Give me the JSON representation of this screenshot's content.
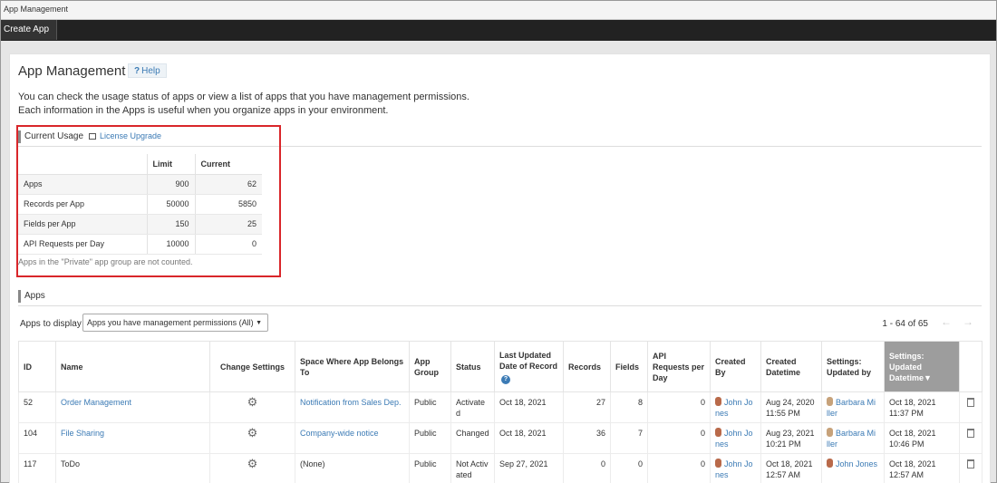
{
  "window_title": "App Management",
  "topbar": {
    "create_app": "Create App"
  },
  "header": {
    "title": "App Management",
    "help_label": "Help",
    "help_icon": "question-icon"
  },
  "description": {
    "line1": "You can check the usage status of apps or view a list of apps that you have management permissions.",
    "line2": "Each information in the Apps is useful when you organize apps in your environment."
  },
  "usage": {
    "section_title": "Current Usage",
    "license_link": "License Upgrade",
    "columns": [
      "",
      "Limit",
      "Current"
    ],
    "rows": [
      {
        "label": "Apps",
        "limit": "900",
        "current": "62"
      },
      {
        "label": "Records per App",
        "limit": "50000",
        "current": "5850"
      },
      {
        "label": "Fields per App",
        "limit": "150",
        "current": "25"
      },
      {
        "label": "API Requests per Day",
        "limit": "10000",
        "current": "0"
      }
    ],
    "note": "Apps in the \"Private\" app group are not counted."
  },
  "apps": {
    "section_title": "Apps",
    "display_label": "Apps to display",
    "display_value": "Apps you have management permissions (All)",
    "paging": "1 - 64 of 65",
    "columns": {
      "id": "ID",
      "name": "Name",
      "change_settings": "Change Settings",
      "space": "Space Where App Belongs To",
      "app_group": "App Group",
      "status": "Status",
      "last_updated": "Last Updated Date of Record",
      "records": "Records",
      "fields": "Fields",
      "api_requests": "API Requests per Day",
      "created_by": "Created By",
      "created_datetime": "Created Datetime",
      "settings_updated_by": "Settings: Updated by",
      "settings_updated_datetime": "Settings: Updated Datetime▼"
    },
    "rows": [
      {
        "id": "52",
        "name": "Order Management",
        "space": "Notification from Sales Dep.",
        "group": "Public",
        "status": "Activate d",
        "last_updated": "Oct 18, 2021",
        "records": "27",
        "fields": "8",
        "api": "0",
        "created_by": "John Jo nes",
        "created": "Aug 24, 2020 11:55 PM",
        "updated_by": "Barbara Mi ller",
        "updated": "Oct 18, 2021 11:37 PM"
      },
      {
        "id": "104",
        "name": "File Sharing",
        "space": "Company-wide notice",
        "group": "Public",
        "status": "Changed",
        "last_updated": "Oct 18, 2021",
        "records": "36",
        "fields": "7",
        "api": "0",
        "created_by": "John Jo nes",
        "created": "Aug 23, 2021 10:21 PM",
        "updated_by": "Barbara Mi ller",
        "updated": "Oct 18, 2021 10:46 PM"
      },
      {
        "id": "117",
        "name": "ToDo",
        "space": "(None)",
        "group": "Public",
        "status": "Not Activ ated",
        "last_updated": "Sep 27, 2021",
        "records": "0",
        "fields": "0",
        "api": "0",
        "created_by": "John Jo nes",
        "created": "Oct 18, 2021 12:57 AM",
        "updated_by": "John Jones",
        "updated": "Oct 18, 2021 12:57 AM"
      }
    ]
  },
  "colors": {
    "link": "#3c7bb5",
    "highlight_box": "#d9262a",
    "topbar": "#222222",
    "sorted_header": "#9d9d9d"
  }
}
